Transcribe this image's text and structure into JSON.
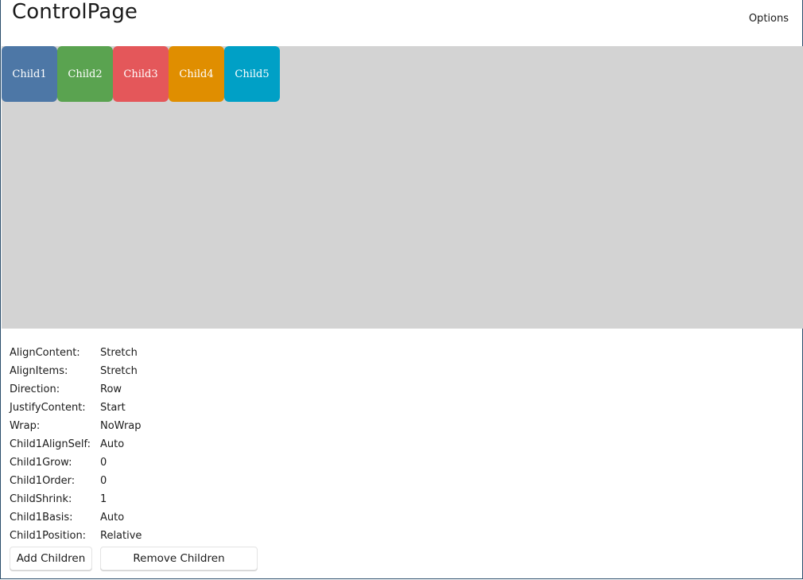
{
  "page": {
    "title": "ControlPage",
    "options_label": "Options"
  },
  "children": [
    {
      "label": "Child1",
      "color": "#4d77a6"
    },
    {
      "label": "Child2",
      "color": "#5aa350"
    },
    {
      "label": "Child3",
      "color": "#e4575a"
    },
    {
      "label": "Child4",
      "color": "#e08e00"
    },
    {
      "label": "Child5",
      "color": "#00a0c6"
    }
  ],
  "properties": [
    {
      "label": "AlignContent:",
      "value": "Stretch"
    },
    {
      "label": "AlignItems:",
      "value": "Stretch"
    },
    {
      "label": "Direction:",
      "value": "Row"
    },
    {
      "label": "JustifyContent:",
      "value": "Start"
    },
    {
      "label": "Wrap:",
      "value": "NoWrap"
    },
    {
      "label": "Child1AlignSelf:",
      "value": "Auto"
    },
    {
      "label": "Child1Grow:",
      "value": "0"
    },
    {
      "label": "Child1Order:",
      "value": "0"
    },
    {
      "label": "ChildShrink:",
      "value": "1"
    },
    {
      "label": "Child1Basis:",
      "value": "Auto"
    },
    {
      "label": "Child1Position:",
      "value": "Relative"
    }
  ],
  "buttons": {
    "add_label": "Add Children",
    "remove_label": "Remove Children"
  },
  "colors": {
    "flex_area_bg": "#d3d3d3",
    "window_border": "#2b4e6b"
  }
}
